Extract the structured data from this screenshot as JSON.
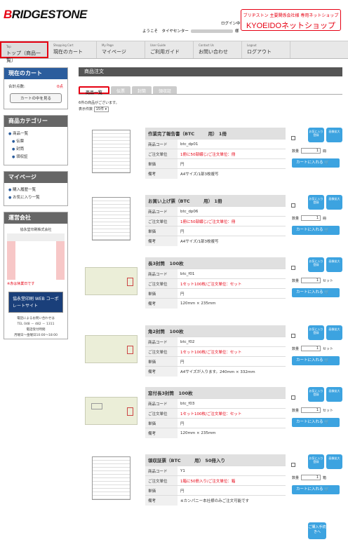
{
  "header": {
    "logo_pre": "B",
    "logo_rest": "RIDGESTONE",
    "login_label": "ログイン中",
    "welcome_pre": "ようこそ　タイヤセンター",
    "welcome_post": "様",
    "brand_sub": "ブリヂストン 主要関係会社様 専用ネットショップ",
    "brand_name": "KYOEIDOネットショップ"
  },
  "nav": [
    {
      "en": "Top",
      "jp": "トップ（商品一覧）"
    },
    {
      "en": "Shopping Cart",
      "jp": "現在のカート"
    },
    {
      "en": "My Page",
      "jp": "マイページ"
    },
    {
      "en": "User Guide",
      "jp": "ご利用ガイド"
    },
    {
      "en": "Contact Us",
      "jp": "お問い合わせ"
    },
    {
      "en": "Logout",
      "jp": "ログアウト"
    }
  ],
  "sidebar": {
    "cart_title": "現在のカート",
    "cart_count_label": "合計点数:",
    "cart_count": "0点",
    "cart_button": "カートの中を見る",
    "cat_title": "商品カテゴリー",
    "categories": [
      "商品一覧",
      "伝票",
      "封筒",
      "領収証"
    ],
    "mypage_title": "マイページ",
    "mypage_items": [
      "購入履歴一覧",
      "お気に入り一覧"
    ],
    "company_title": "運営会社",
    "company_name": "協永堂印刷株式会社",
    "holiday_note": "※赤は休業日です",
    "banner_text": "協永堂印刷 WEB コーポレートサイト",
    "contact1": "電話によるお問い合わせは",
    "contact2": "TEL 048 － 482 － 1311",
    "contact3": "電話受付時間",
    "contact4": "月曜日～金曜日10:00～18:00"
  },
  "main": {
    "title": "商品注文",
    "tabs": [
      "商品一覧",
      "伝票",
      "封筒",
      "領収証"
    ],
    "count_text": "6件の商品がございます。",
    "display_label": "表示件数",
    "display_value": "15件"
  },
  "labels": {
    "code": "商品コード",
    "unit": "ご注文単位",
    "price": "単価",
    "note": "備考",
    "qty": "数量",
    "fav": "お気に入り登録",
    "zoom": "画像拡大",
    "add": "カートに入れる",
    "checkout": "ご購入手続きへ"
  },
  "products": [
    {
      "name": "作業完了報告書（BTC　　　用） 1冊",
      "code": "btc_dp01",
      "unit": "1冊に50部綴じ/ご注文単位：冊",
      "price": "円",
      "note": "A4サイズ/1部3枚複写",
      "qty": "1",
      "qty_unit": "冊"
    },
    {
      "name": "お買い上げ票（BTC　　　用） 1冊",
      "code": "btc_dp06",
      "unit": "1冊に50部綴じ/ご注文単位：冊",
      "price": "円",
      "note": "A4サイズ/1部3枚複写",
      "qty": "1",
      "qty_unit": "冊"
    },
    {
      "name": "長3封筒　100枚",
      "code": "btc_f01",
      "unit": "1セット100枚/ご注文単位：セット",
      "price": "円",
      "note": "120mm × 235mm",
      "qty": "1",
      "qty_unit": "セット"
    },
    {
      "name": "角2封筒　100枚",
      "code": "btc_f02",
      "unit": "1セット100枚/ご注文単位：セット",
      "price": "円",
      "note": "A4サイズが入ります。240mm × 332mm",
      "qty": "1",
      "qty_unit": "セット"
    },
    {
      "name": "窓付長3封筒　100枚",
      "code": "btc_f03",
      "unit": "1セット100枚/ご注文単位：セット",
      "price": "円",
      "note": "120mm × 235mm",
      "qty": "1",
      "qty_unit": "セット"
    },
    {
      "name": "領収証票（BTC　　　用） 50冊入り",
      "code": "Y1",
      "unit": "1箱に50冊入り/ご注文単位：箱",
      "price": "円",
      "note": "※カンパニー本社様のみご注文可能です",
      "qty": "1",
      "qty_unit": "箱"
    }
  ]
}
